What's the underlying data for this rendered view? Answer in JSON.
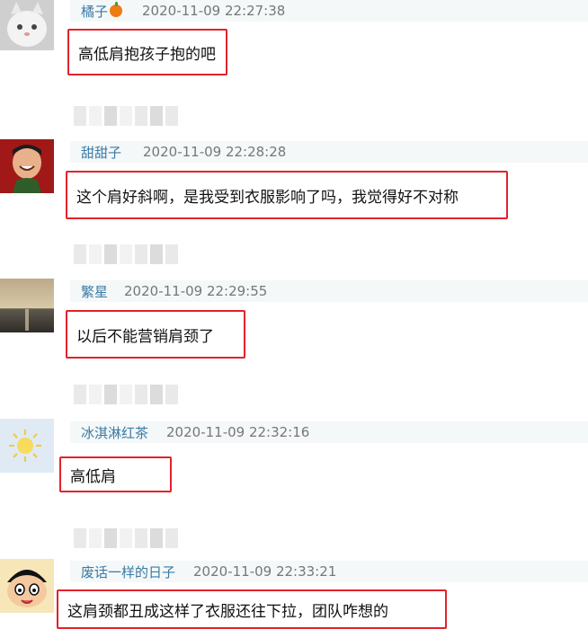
{
  "comments": [
    {
      "user": "橘子",
      "time": "2020-11-09 22:27:38",
      "text": "高低肩抱孩子抱的吧",
      "badge": "orange-icon"
    },
    {
      "user": "甜甜子",
      "time": "2020-11-09 22:28:28",
      "text": "这个肩好斜啊，是我受到衣服影响了吗，我觉得好不对称"
    },
    {
      "user": "繁星",
      "time": "2020-11-09 22:29:55",
      "text": "以后不能营销肩颈了"
    },
    {
      "user": "冰淇淋红茶",
      "time": "2020-11-09 22:32:16",
      "text": "高低肩"
    },
    {
      "user": "废话一样的日子",
      "time": "2020-11-09 22:33:21",
      "text": "这肩颈都丑成这样了衣服还往下拉，团队咋想的"
    }
  ],
  "colors": {
    "highlight": "#e2222a",
    "username": "#3a7aa6",
    "header_bg": "#f4f8f8"
  }
}
